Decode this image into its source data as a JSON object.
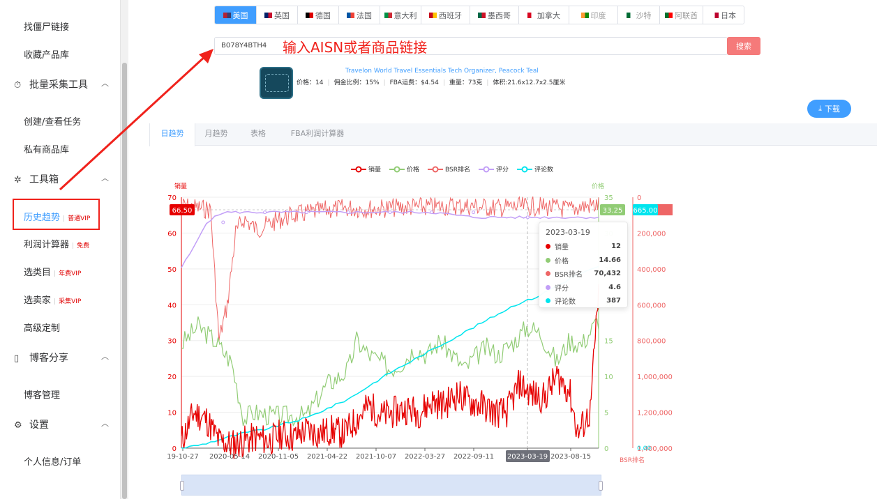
{
  "sidebar": {
    "items": [
      {
        "label": "找僵尸链接",
        "kind": "item"
      },
      {
        "label": "收藏产品库",
        "kind": "item"
      },
      {
        "label": "批量采集工具",
        "kind": "group",
        "icon": "timer-icon"
      },
      {
        "label": "创建/查看任务",
        "kind": "item"
      },
      {
        "label": "私有商品库",
        "kind": "item"
      },
      {
        "label": "工具箱",
        "kind": "group",
        "icon": "magic-icon"
      },
      {
        "label": "历史趋势",
        "tag": "普通VIP",
        "kind": "active"
      },
      {
        "label": "利润计算器",
        "tag": "免费",
        "kind": "item"
      },
      {
        "label": "选类目",
        "tag": "年费VIP",
        "kind": "item"
      },
      {
        "label": "选卖家",
        "tag": "采集VIP",
        "kind": "item"
      },
      {
        "label": "高级定制",
        "kind": "item"
      },
      {
        "label": "博客分享",
        "kind": "group",
        "icon": "book-icon"
      },
      {
        "label": "博客管理",
        "kind": "item"
      },
      {
        "label": "设置",
        "kind": "group",
        "icon": "gear-icon"
      },
      {
        "label": "个人信息/订单",
        "kind": "item"
      }
    ]
  },
  "countries": [
    {
      "label": "美国",
      "active": true,
      "colors": [
        "#b22234",
        "#3c3b6e"
      ]
    },
    {
      "label": "英国",
      "colors": [
        "#012169",
        "#c8102e"
      ]
    },
    {
      "label": "德国",
      "colors": [
        "#000000",
        "#dd0000"
      ]
    },
    {
      "label": "法国",
      "colors": [
        "#0055a4",
        "#ef4135"
      ]
    },
    {
      "label": "意大利",
      "colors": [
        "#009246",
        "#ce2b37"
      ]
    },
    {
      "label": "西班牙",
      "colors": [
        "#c60b1e",
        "#ffc400"
      ]
    },
    {
      "label": "墨西哥",
      "colors": [
        "#006847",
        "#ce1126"
      ]
    },
    {
      "label": "加拿大",
      "colors": [
        "#d80621",
        "#ffffff"
      ]
    },
    {
      "label": "印度",
      "dim": true,
      "colors": [
        "#ff9933",
        "#138808"
      ]
    },
    {
      "label": "沙特",
      "dim": true,
      "colors": [
        "#006c35",
        "#ffffff"
      ]
    },
    {
      "label": "阿联酋",
      "dim": true,
      "colors": [
        "#00732f",
        "#ff0000"
      ]
    },
    {
      "label": "日本",
      "colors": [
        "#ffffff",
        "#bc002d"
      ]
    }
  ],
  "search": {
    "value": "B078Y4BTH4",
    "hint": "输入AISN或者商品链接",
    "button": "搜索"
  },
  "product": {
    "title": "Travelon World Travel Essentials Tech Organizer, Peacock Teal",
    "info": [
      "价格：14",
      "佣金比例：15%",
      "FBA运费：$4.54",
      "重量：73克",
      "体积:21.6x12.7x2.5厘米"
    ]
  },
  "download_label": "下载",
  "tabs": [
    "日趋势",
    "月趋势",
    "表格",
    "FBA利润计算器"
  ],
  "legend": [
    {
      "label": "销量",
      "color": "#e60000"
    },
    {
      "label": "价格",
      "color": "#91cc75"
    },
    {
      "label": "BSR排名",
      "color": "#ee6666"
    },
    {
      "label": "评分",
      "color": "#c29ff7"
    },
    {
      "label": "评论数",
      "color": "#00e5ee"
    }
  ],
  "chart_data": {
    "type": "line",
    "x_ticks": [
      "2019-10-27",
      "2020-05-14",
      "2020-11-05",
      "2021-04-22",
      "2021-10-07",
      "2022-03-27",
      "2022-09-11",
      "2023-03-19",
      "2023-08-15"
    ],
    "x_ticks_display": [
      "19-10-27",
      "2020-05-14",
      "2020-11-05",
      "2021-04-22",
      "2021-10-07",
      "2022-03-27",
      "2022-09-11",
      "2023-03-19",
      "2023-08-15"
    ],
    "y_left_label": "销量",
    "y_left_ticks": [
      "0",
      "10",
      "20",
      "30",
      "40",
      "50",
      "60",
      "70"
    ],
    "y_left_range": [
      0,
      70
    ],
    "y_price_label": "价格",
    "y_price_ticks": [
      "0",
      "5",
      "10",
      "15",
      "20",
      "25",
      "30",
      "35"
    ],
    "y_price_range": [
      0,
      35
    ],
    "y_bsr_label": "BSR排名",
    "y_bsr_ticks": [
      "0",
      "200,000",
      "400,000",
      "600,000",
      "800,000",
      "1,000,000",
      "1,200,000",
      "1,400,000"
    ],
    "y_bsr_range": [
      0,
      1400000
    ],
    "y_bsr_inverse": true,
    "markers": {
      "sales_max": "66.50",
      "price_max": "33.25",
      "review_max": "665.00",
      "review_min": "0.00"
    },
    "series": [
      {
        "name": "销量",
        "color": "#e60000",
        "points": [
          [
            0,
            2
          ],
          [
            0.03,
            10
          ],
          [
            0.06,
            8
          ],
          [
            0.09,
            2
          ],
          [
            0.12,
            1
          ],
          [
            0.15,
            2
          ],
          [
            0.18,
            3
          ],
          [
            0.21,
            2
          ],
          [
            0.24,
            4
          ],
          [
            0.27,
            3
          ],
          [
            0.3,
            5
          ],
          [
            0.33,
            4
          ],
          [
            0.36,
            5
          ],
          [
            0.39,
            4
          ],
          [
            0.42,
            8
          ],
          [
            0.45,
            12
          ],
          [
            0.48,
            9
          ],
          [
            0.51,
            10
          ],
          [
            0.54,
            11
          ],
          [
            0.57,
            10
          ],
          [
            0.6,
            13
          ],
          [
            0.63,
            12
          ],
          [
            0.66,
            15
          ],
          [
            0.69,
            13
          ],
          [
            0.72,
            12
          ],
          [
            0.75,
            10
          ],
          [
            0.78,
            10
          ],
          [
            0.81,
            18
          ],
          [
            0.84,
            15
          ],
          [
            0.87,
            14
          ],
          [
            0.9,
            20
          ],
          [
            0.93,
            16
          ],
          [
            0.95,
            4
          ],
          [
            0.98,
            10
          ],
          [
            1,
            44
          ]
        ]
      },
      {
        "name": "价格",
        "color": "#91cc75",
        "points": [
          [
            0,
            14.5
          ],
          [
            0.04,
            17
          ],
          [
            0.08,
            15
          ],
          [
            0.12,
            12
          ],
          [
            0.15,
            4
          ],
          [
            0.17,
            5
          ],
          [
            0.22,
            4.5
          ],
          [
            0.3,
            4.5
          ],
          [
            0.35,
            9
          ],
          [
            0.38,
            10
          ],
          [
            0.4,
            11
          ],
          [
            0.42,
            15
          ],
          [
            0.45,
            13
          ],
          [
            0.48,
            12
          ],
          [
            0.5,
            11
          ],
          [
            0.53,
            12
          ],
          [
            0.56,
            14
          ],
          [
            0.59,
            13
          ],
          [
            0.62,
            15
          ],
          [
            0.65,
            13
          ],
          [
            0.68,
            11
          ],
          [
            0.7,
            12.5
          ],
          [
            0.73,
            14
          ],
          [
            0.76,
            13
          ],
          [
            0.8,
            15
          ],
          [
            0.83,
            17
          ],
          [
            0.86,
            16
          ],
          [
            0.9,
            12
          ],
          [
            0.93,
            15
          ],
          [
            0.96,
            14.5
          ],
          [
            1,
            18
          ]
        ]
      },
      {
        "name": "BSR排名",
        "color": "#ee6666",
        "points": [
          [
            0,
            50000
          ],
          [
            0.04,
            60000
          ],
          [
            0.07,
            70000
          ],
          [
            0.09,
            800000
          ],
          [
            0.11,
            600000
          ],
          [
            0.13,
            200000
          ],
          [
            0.15,
            120000
          ],
          [
            0.18,
            180000
          ],
          [
            0.21,
            150000
          ],
          [
            0.24,
            120000
          ],
          [
            0.27,
            100000
          ],
          [
            0.3,
            90000
          ],
          [
            0.35,
            70000
          ],
          [
            0.4,
            60000
          ],
          [
            0.45,
            65000
          ],
          [
            0.5,
            60000
          ],
          [
            0.55,
            55000
          ],
          [
            0.6,
            55000
          ],
          [
            0.65,
            50000
          ],
          [
            0.7,
            50000
          ],
          [
            0.75,
            60000
          ],
          [
            0.8,
            55000
          ],
          [
            0.85,
            50000
          ],
          [
            0.9,
            60000
          ],
          [
            0.93,
            70000
          ],
          [
            0.96,
            50000
          ],
          [
            1,
            45000
          ]
        ]
      },
      {
        "name": "评分",
        "color": "#c29ff7",
        "points": [
          [
            0,
            3.6
          ],
          [
            0.03,
            4
          ],
          [
            0.06,
            4.5
          ],
          [
            0.1,
            4.7
          ],
          [
            0.2,
            4.7
          ],
          [
            0.3,
            4.7
          ],
          [
            0.4,
            4.7
          ],
          [
            0.5,
            4.7
          ],
          [
            0.6,
            4.7
          ],
          [
            0.7,
            4.6
          ],
          [
            0.8,
            4.6
          ],
          [
            0.9,
            4.6
          ],
          [
            0.95,
            4.6
          ],
          [
            1,
            4.6
          ]
        ]
      },
      {
        "name": "评论数",
        "color": "#00e5ee",
        "points": [
          [
            0,
            0
          ],
          [
            0.05,
            10
          ],
          [
            0.1,
            25
          ],
          [
            0.15,
            40
          ],
          [
            0.2,
            50
          ],
          [
            0.3,
            80
          ],
          [
            0.4,
            130
          ],
          [
            0.5,
            200
          ],
          [
            0.6,
            260
          ],
          [
            0.7,
            320
          ],
          [
            0.8,
            380
          ],
          [
            0.85,
            400
          ],
          [
            0.9,
            430
          ],
          [
            0.95,
            460
          ],
          [
            1,
            480
          ]
        ]
      }
    ]
  },
  "tooltip": {
    "date": "2023-03-19",
    "rows": [
      {
        "label": "销量",
        "value": "12",
        "color": "#e60000"
      },
      {
        "label": "价格",
        "value": "14.66",
        "color": "#91cc75"
      },
      {
        "label": "BSR排名",
        "value": "70,432",
        "color": "#ee6666"
      },
      {
        "label": "评分",
        "value": "4.6",
        "color": "#c29ff7"
      },
      {
        "label": "评论数",
        "value": "387",
        "color": "#00e5ee"
      }
    ]
  }
}
